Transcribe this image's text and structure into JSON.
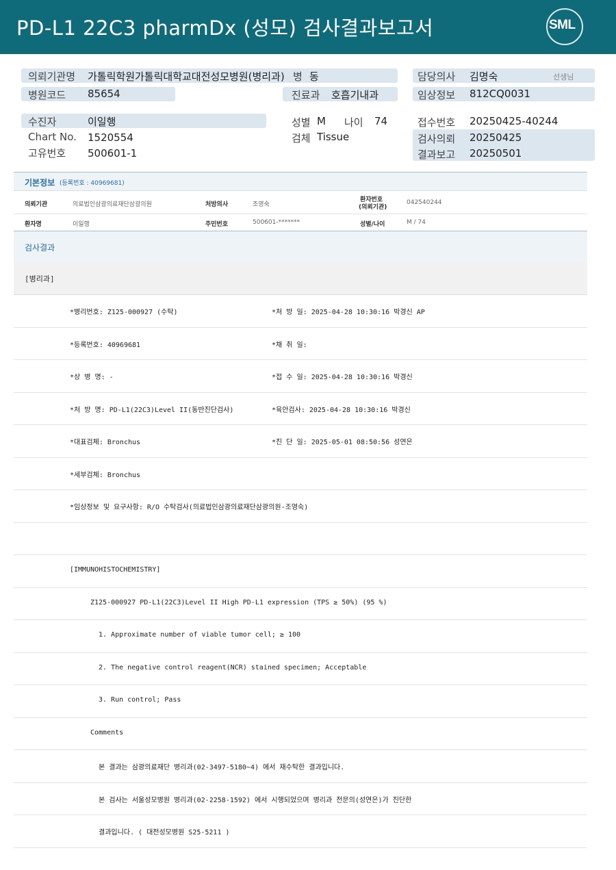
{
  "header": {
    "title": "PD-L1 22C3 pharmDx (성모) 검사결과보고서",
    "logo": "SML"
  },
  "info": {
    "institution_label": "의뢰기관명",
    "institution_value": "가톨릭학원가톨릭대학교대전성모병원(병리과)",
    "ward_label": "병",
    "ward_value": "동",
    "doctor_label": "담당의사",
    "doctor_value": "김명숙",
    "doctor_suffix": "선생님",
    "hospital_code_label": "병원코드",
    "hospital_code_value": "85654",
    "dept_label": "진료과",
    "dept_value": "호흡기내과",
    "clinical_label": "임상정보",
    "clinical_value": "812CQ0031",
    "patient_label": "수진자",
    "patient_value": "이일행",
    "sex_label": "성별",
    "sex_value": "M",
    "age_label": "나이",
    "age_value": "74",
    "receipt_label": "접수번호",
    "receipt_value": "20250425-40244",
    "chart_label": "Chart No.",
    "chart_value": "1520554",
    "specimen_label": "검체",
    "specimen_value": "Tissue",
    "request_label": "검사의뢰",
    "request_value": "20250425",
    "uid_label": "고유번호",
    "uid_value": "500601-1",
    "report_label": "결과보고",
    "report_value": "20250501"
  },
  "basic": {
    "title": "기본정보",
    "reg": "(등록번호 : 40969681)",
    "r1": {
      "l1": "의뢰기관",
      "v1": "의료법인삼광의료재단삼광의원",
      "l2": "처방의사",
      "v2": "조영숙",
      "l3a": "환자번호",
      "l3b": "(의뢰기관)",
      "v3": "042540244"
    },
    "r2": {
      "l1": "환자명",
      "v1": "이일행",
      "l2": "주민번호",
      "v2": "500601-*******",
      "l3": "성별/나이",
      "v3": "M / 74"
    }
  },
  "result": {
    "title": "검사결과",
    "dept": "[병리과]"
  },
  "lines": [
    {
      "a": "*병리번호: Z125-000927 (수탁)",
      "b": "*처 방 일: 2025-04-28 10:30:16  박경신 AP"
    },
    {
      "a": "*등록번호: 40969681",
      "b": "*채 취 일:"
    },
    {
      "a": "*상 병 명: -",
      "b": "*접 수 일: 2025-04-28 10:30:16  박경신"
    },
    {
      "a": "*처 방 명: PD-L1(22C3)Level II(동반진단검사)",
      "b": "*육안검사: 2025-04-28 10:30:16  박경신"
    },
    {
      "a": "*대표검체: Bronchus",
      "b": "*진 단 일: 2025-05-01 08:50:56  성연은"
    },
    {
      "a": "*세부검체: Bronchus",
      "b": ""
    },
    {
      "a": "*임상정보 및 요구사항: R/O 수탁검사(의료법인삼광의료재단삼광의원-조영숙)",
      "b": ""
    },
    {
      "a": "",
      "b": ""
    },
    {
      "a": " [IMMUNOHISTOCHEMISTRY]",
      "b": ""
    },
    {
      "a": "Z125-000927      PD-L1(22C3)Level II        High PD-L1 expression (TPS ≥ 50%) (95 %)",
      "b": "",
      "indent": 1
    },
    {
      "a": "1. Approximate number of viable tumor cell; ≥ 100",
      "b": "",
      "indent": 2
    },
    {
      "a": "2. The negative control reagent(NCR) stained specimen; Acceptable",
      "b": "",
      "indent": 2
    },
    {
      "a": "3. Run control; Pass",
      "b": "",
      "indent": 2
    },
    {
      "a": "Comments",
      "b": "",
      "indent": 1
    },
    {
      "a": "본 결과는 삼광의료재단 병리과(02-3497-5180~4) 에서 재수탁한 결과입니다.",
      "b": "",
      "indent": 2
    },
    {
      "a": "본 검사는 서울성모병원 병리과(02-2258-1592) 에서 시행되었으며 병리과 전문의(성연은)가 진단한",
      "b": "",
      "indent": 2
    },
    {
      "a": "결과입니다. ( 대전성모병원 S25-5211 )",
      "b": "",
      "indent": 2
    }
  ]
}
